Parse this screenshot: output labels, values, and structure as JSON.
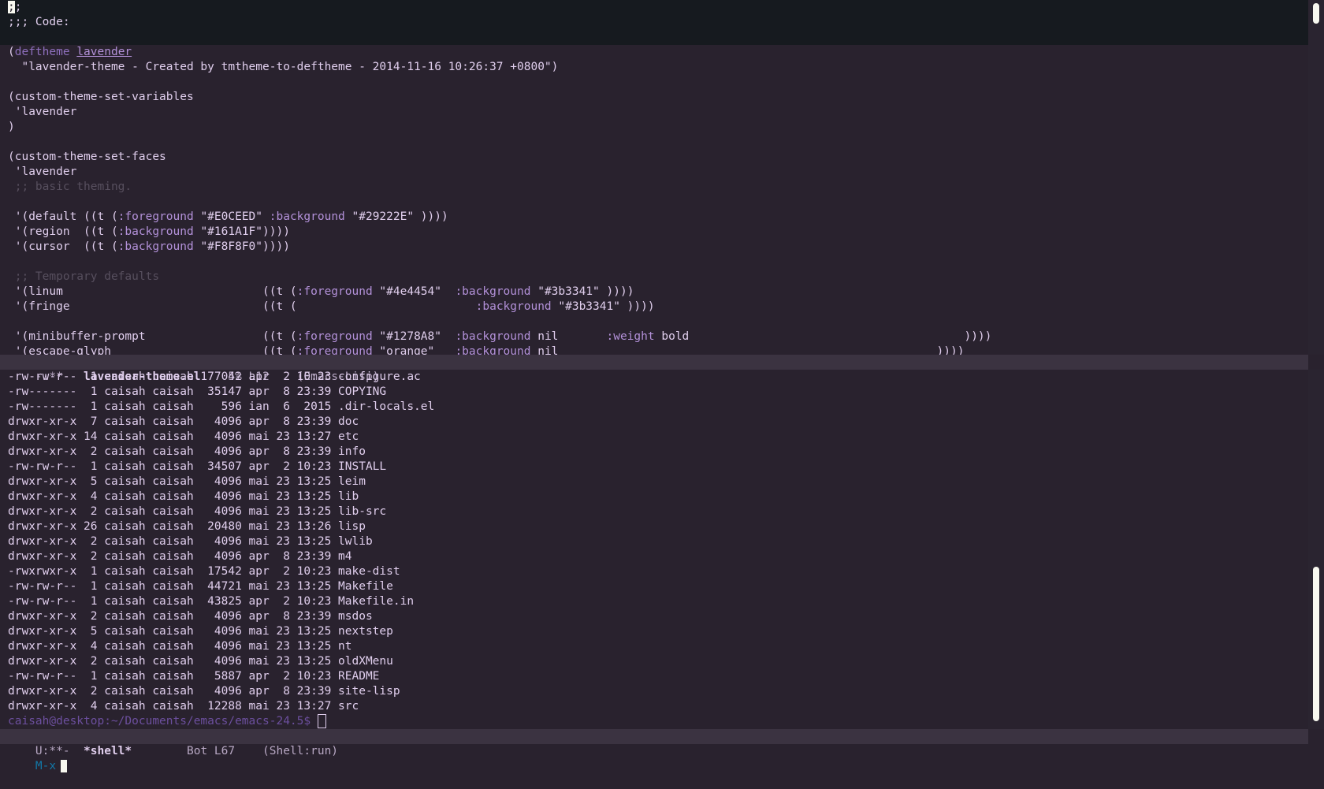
{
  "top_window": {
    "header_lines": [
      ";;",
      ";;; Code:"
    ],
    "code": {
      "deftheme_open": "(",
      "deftheme_kw": "deftheme",
      "deftheme_name": "lavender",
      "doc_line": "  \"lavender-theme - Created by tmtheme-to-deftheme - 2014-11-16 10:26:37 +0800\")",
      "vars_1": "(custom-theme-set-variables",
      "vars_2": " 'lavender",
      "vars_3": ")",
      "faces_1": "(custom-theme-set-faces",
      "faces_2": " 'lavender",
      "comment_basic": " ;; basic theming.",
      "default_a": " '(default ((t (",
      "default_fg_kw": ":foreground",
      "default_fg_val": " \"#E0CEED\" ",
      "default_bg_kw": ":background",
      "default_bg_val": " \"#29222E\" ))))",
      "region_a": " '(region  ((t (",
      "region_bg_kw": ":background",
      "region_bg_val": " \"#161A1F\"))))",
      "cursor_a": " '(cursor  ((t (",
      "cursor_bg_kw": ":background",
      "cursor_bg_val": " \"#F8F8F0\"))))",
      "comment_temp": " ;; Temporary defaults",
      "linum_a": " '(linum                             ((t (",
      "linum_fg_kw": ":foreground",
      "linum_fg_val": " \"#4e4454\"  ",
      "linum_bg_kw": ":background",
      "linum_bg_val": " \"#3b3341\" ))))",
      "fringe_a": " '(fringe                            ((t (                          ",
      "fringe_bg_kw": ":background",
      "fringe_bg_val": " \"#3b3341\" ))))",
      "mb_a": " '(minibuffer-prompt                 ((t (",
      "mb_fg_kw": ":foreground",
      "mb_fg_val": " \"#1278A8\"  ",
      "mb_bg_kw": ":background",
      "mb_bg_val": " nil       ",
      "mb_wt_kw": ":weight",
      "mb_wt_val": " bold                                        ))))",
      "esc_a": " '(escape-glyph                      ((t (",
      "esc_fg_kw": ":foreground",
      "esc_fg_val": " \"orange\"   ",
      "esc_bg_kw": ":background",
      "esc_bg_val": " nil                                                       ))))"
    }
  },
  "top_modeline": {
    "status": "-:**-  ",
    "buffer": "lavender-theme.el",
    "position": "    5% L12    (Emacs-Lisp)"
  },
  "shell": {
    "listing": [
      "-rw-rw-r--  1 caisah caisah 177042 apr  2 10:23 configure.ac",
      "-rw-------  1 caisah caisah  35147 apr  8 23:39 COPYING",
      "-rw-------  1 caisah caisah    596 ian  6  2015 .dir-locals.el",
      "drwxr-xr-x  7 caisah caisah   4096 apr  8 23:39 doc",
      "drwxr-xr-x 14 caisah caisah   4096 mai 23 13:27 etc",
      "drwxr-xr-x  2 caisah caisah   4096 apr  8 23:39 info",
      "-rw-rw-r--  1 caisah caisah  34507 apr  2 10:23 INSTALL",
      "drwxr-xr-x  5 caisah caisah   4096 mai 23 13:25 leim",
      "drwxr-xr-x  4 caisah caisah   4096 mai 23 13:25 lib",
      "drwxr-xr-x  2 caisah caisah   4096 mai 23 13:25 lib-src",
      "drwxr-xr-x 26 caisah caisah  20480 mai 23 13:26 lisp",
      "drwxr-xr-x  2 caisah caisah   4096 mai 23 13:25 lwlib",
      "drwxr-xr-x  2 caisah caisah   4096 apr  8 23:39 m4",
      "-rwxrwxr-x  1 caisah caisah  17542 apr  2 10:23 make-dist",
      "-rw-rw-r--  1 caisah caisah  44721 mai 23 13:25 Makefile",
      "-rw-rw-r--  1 caisah caisah  43825 apr  2 10:23 Makefile.in",
      "drwxr-xr-x  2 caisah caisah   4096 apr  8 23:39 msdos",
      "drwxr-xr-x  5 caisah caisah   4096 mai 23 13:25 nextstep",
      "drwxr-xr-x  4 caisah caisah   4096 mai 23 13:25 nt",
      "drwxr-xr-x  2 caisah caisah   4096 mai 23 13:25 oldXMenu",
      "-rw-rw-r--  1 caisah caisah   5887 apr  2 10:23 README",
      "drwxr-xr-x  2 caisah caisah   4096 apr  8 23:39 site-lisp",
      "drwxr-xr-x  4 caisah caisah  12288 mai 23 13:27 src"
    ],
    "prompt": "caisah@desktop:~/Documents/emacs/emacs-24.5$ "
  },
  "shell_modeline": {
    "status": "U:**-  ",
    "buffer": "*shell*",
    "position": "        Bot L67    (Shell:run)"
  },
  "minibuffer": {
    "prompt": "M-x"
  },
  "colors": {
    "background": "#29222E",
    "foreground": "#E0CEED",
    "region": "#161A1F",
    "cursor": "#F8F8F0",
    "modeline": "#3b3341",
    "minibuffer_prompt": "#1278A8"
  }
}
